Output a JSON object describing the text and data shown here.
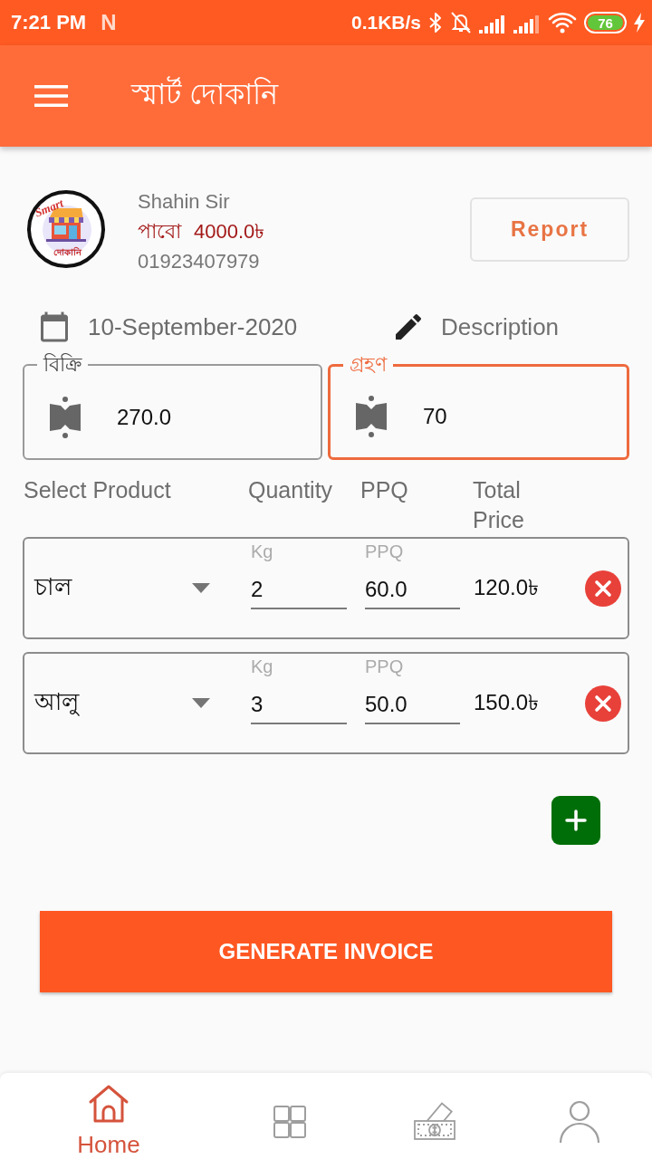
{
  "status_bar": {
    "time": "7:21 PM",
    "notification_icon": "N",
    "network_speed": "0.1KB/s",
    "battery": "76"
  },
  "app_bar": {
    "title": "স্মার্ট দোকানি"
  },
  "customer": {
    "logo": {
      "script": "Smart",
      "caption": "দোকানি"
    },
    "name": "Shahin Sir",
    "due_label": "পাবো",
    "due_amount": "4000.0৳",
    "phone": "01923407979"
  },
  "report_button": "Report",
  "date": "10-September-2020",
  "description": {
    "placeholder": "Description"
  },
  "amount_fields": [
    {
      "label": "বিক্রি",
      "value": "270.0",
      "focused": false
    },
    {
      "label": "গ্রহণ",
      "value": "70",
      "focused": true
    }
  ],
  "columns": [
    "Select Product",
    "Quantity",
    "PPQ",
    "Total Price"
  ],
  "items": [
    {
      "product": "চাল",
      "quantity_label": "Kg",
      "quantity": "2",
      "price_label": "PPQ",
      "price": "60.0",
      "total": "120.0৳"
    },
    {
      "product": "আলু",
      "quantity_label": "Kg",
      "quantity": "3",
      "price_label": "PPQ",
      "price": "50.0",
      "total": "150.0৳"
    }
  ],
  "generate_button": "GENERATE INVOICE",
  "bottom_nav": [
    {
      "kind": "home",
      "label": "Home",
      "selected": true
    },
    {
      "kind": "grid",
      "selected": false
    },
    {
      "kind": "money",
      "selected": false
    },
    {
      "kind": "person",
      "selected": false
    }
  ]
}
